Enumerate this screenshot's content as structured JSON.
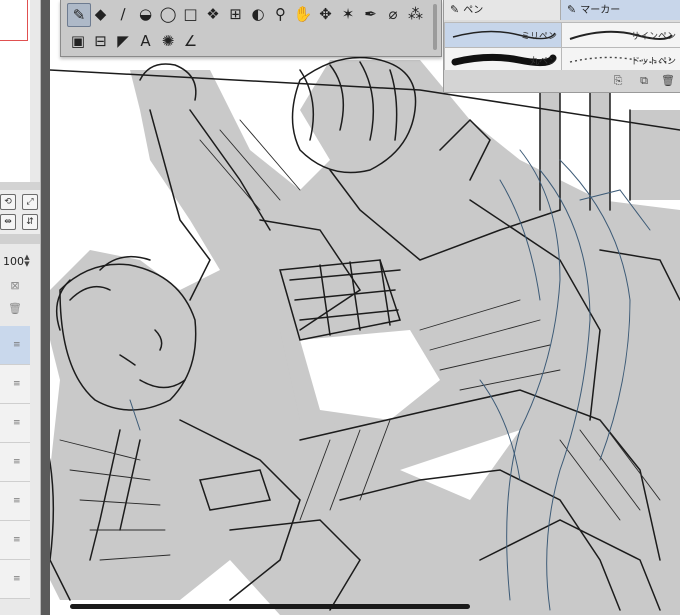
{
  "left_panel": {
    "opacity_value": "100",
    "layer_rows": 7
  },
  "tool_palette": {
    "row1": [
      {
        "name": "pen-tool-icon",
        "glyph": "✎",
        "active": true
      },
      {
        "name": "eraser-tool-icon",
        "glyph": "◆"
      },
      {
        "name": "brush-tool-icon",
        "glyph": "∕"
      },
      {
        "name": "fill-tool-icon",
        "glyph": "◒"
      },
      {
        "name": "lasso-tool-icon",
        "glyph": "◯"
      },
      {
        "name": "rect-select-tool-icon",
        "glyph": "□"
      },
      {
        "name": "layer-select-tool-icon",
        "glyph": "❖"
      },
      {
        "name": "stamp-tool-icon",
        "glyph": "⊞"
      },
      {
        "name": "droplet-tool-icon",
        "glyph": "◐"
      },
      {
        "name": "zoom-tool-icon",
        "glyph": "⚲"
      },
      {
        "name": "hand-tool-icon",
        "glyph": "✋"
      },
      {
        "name": "move-tool-icon",
        "glyph": "✥"
      },
      {
        "name": "sparkle-tool-icon",
        "glyph": "✶"
      },
      {
        "name": "pen-nib-tool-icon",
        "glyph": "✒"
      },
      {
        "name": "marker-tool-icon",
        "glyph": "⌀"
      },
      {
        "name": "decoration-tool-icon",
        "glyph": "⁂"
      }
    ],
    "row2": [
      {
        "name": "gradient-tool-icon",
        "glyph": "▣"
      },
      {
        "name": "frame-tool-icon",
        "glyph": "⊟"
      },
      {
        "name": "ruler-tool-icon",
        "glyph": "◤"
      },
      {
        "name": "text-tool-icon",
        "glyph": "A"
      },
      {
        "name": "balloon-tool-icon",
        "glyph": "✺"
      },
      {
        "name": "correction-tool-icon",
        "glyph": "∠"
      }
    ]
  },
  "brush_panel": {
    "tabs": [
      {
        "label": "ペン",
        "icon": "✎"
      },
      {
        "label": "マーカー",
        "icon": "✎"
      }
    ],
    "brushes": [
      {
        "label": "ミリペン",
        "selected": true
      },
      {
        "label": "サインペン",
        "selected": false
      },
      {
        "label": "丸ペン",
        "selected": false
      },
      {
        "label": "ドットペン",
        "selected": false
      }
    ],
    "footer_icons": [
      "add-icon",
      "duplicate-icon",
      "trash-icon"
    ]
  },
  "colors": {
    "artwork_gray": "#c8c8c8",
    "lineart": "#1c1c1c",
    "blue_sketch": "#3d5b77",
    "accent_blue": "#c6d5ea"
  }
}
